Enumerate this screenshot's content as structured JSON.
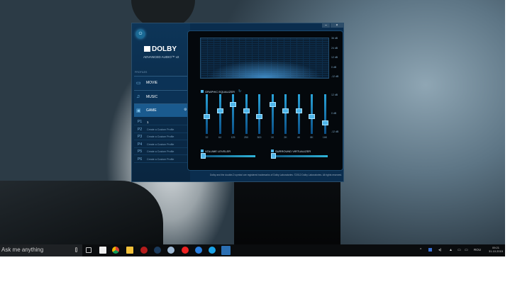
{
  "taskbar": {
    "search_placeholder": "Ask me anything",
    "time": "09:21",
    "date": "31.10.2015",
    "language": "ROU",
    "pinned_icons": [
      "task-view-icon",
      "store-icon",
      "chrome-icon",
      "file-explorer-icon",
      "app-red-icon",
      "steam-icon",
      "app-blue-icon",
      "app-flash-icon",
      "app-blue2-icon",
      "skype-icon",
      "dolby-icon"
    ]
  },
  "dolby": {
    "logo": "DOLBY",
    "subtitle": "ADVANCED AUDIO™ v2",
    "profiles_label": "PROFILES",
    "profiles": [
      {
        "label": "MOVIE",
        "icon": "movie-icon"
      },
      {
        "label": "MUSIC",
        "icon": "music-icon"
      },
      {
        "label": "GAME",
        "icon": "game-icon",
        "selected": true
      }
    ],
    "custom_profiles": [
      {
        "id": "P1",
        "name": "1"
      },
      {
        "id": "P2",
        "name": "Create a Custom Profile"
      },
      {
        "id": "P3",
        "name": "Create a Custom Profile"
      },
      {
        "id": "P4",
        "name": "Create a Custom Profile"
      },
      {
        "id": "P5",
        "name": "Create a Custom Profile"
      },
      {
        "id": "P6",
        "name": "Create a Custom Profile"
      }
    ],
    "graph_axis": [
      "36 dB",
      "24 dB",
      "12 dB",
      "0 dB",
      "-12 dB"
    ],
    "equalizer": {
      "label": "GRAPHIC EQUALIZER",
      "enabled": true,
      "axis": [
        "12 dB",
        "0 dB",
        "-12 dB"
      ],
      "bands": [
        {
          "freq": "32",
          "db": -1
        },
        {
          "freq": "64",
          "db": 3
        },
        {
          "freq": "125",
          "db": 7
        },
        {
          "freq": "250",
          "db": 3
        },
        {
          "freq": "500",
          "db": -1
        },
        {
          "freq": "1K",
          "db": 7
        },
        {
          "freq": "2K",
          "db": 3
        },
        {
          "freq": "4K",
          "db": 3
        },
        {
          "freq": "8K",
          "db": -1
        },
        {
          "freq": "16K",
          "db": -5
        }
      ]
    },
    "volume_leveler": {
      "label": "VOLUME LEVELER",
      "enabled": true,
      "value": 0
    },
    "surround_virtualizer": {
      "label": "SURROUND VIRTUALIZER",
      "enabled": true,
      "value": 0
    },
    "footer": "Dolby and the double-D symbol are registered trademarks of Dolby Laboratories. ©2012 Dolby Laboratories. All rights reserved.",
    "accent": "#4fb6ea"
  }
}
